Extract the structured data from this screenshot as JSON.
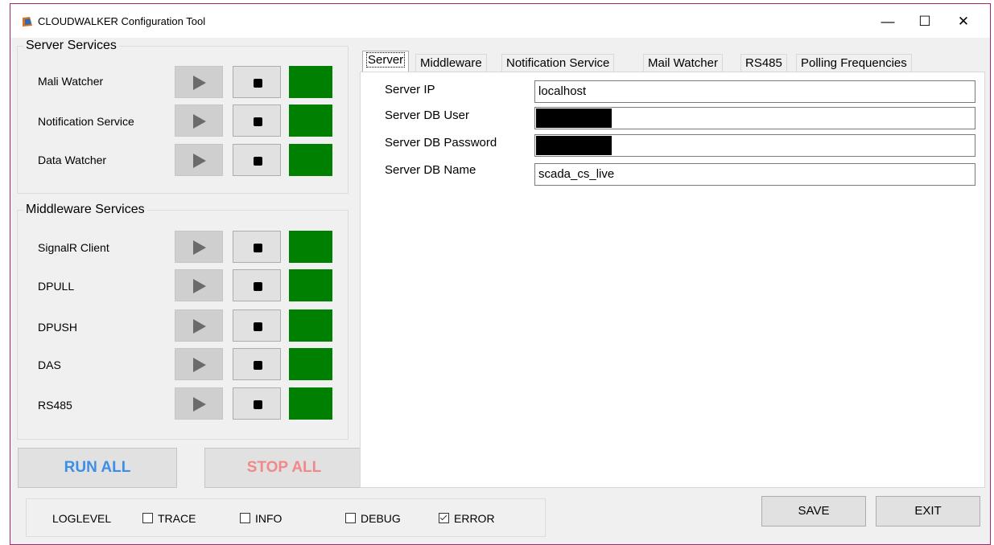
{
  "window": {
    "title": "CLOUDWALKER Configuration Tool",
    "controls": {
      "minimize": "—",
      "maximize": "☐",
      "close": "✕"
    }
  },
  "server_services": {
    "title": "Server Services",
    "items": [
      {
        "label": "Mali Watcher"
      },
      {
        "label": "Notification Service"
      },
      {
        "label": "Data Watcher"
      }
    ]
  },
  "middleware_services": {
    "title": "Middleware Services",
    "items": [
      {
        "label": "SignalR Client"
      },
      {
        "label": "DPULL"
      },
      {
        "label": "DPUSH"
      },
      {
        "label": "DAS"
      },
      {
        "label": "RS485"
      }
    ]
  },
  "actions": {
    "run_all": "RUN ALL",
    "stop_all": "STOP ALL"
  },
  "loglevel": {
    "label": "LOGLEVEL",
    "options": [
      {
        "label": "TRACE",
        "checked": false
      },
      {
        "label": "INFO",
        "checked": false
      },
      {
        "label": "DEBUG",
        "checked": false
      },
      {
        "label": "ERROR",
        "checked": true
      }
    ]
  },
  "tabs": [
    "Server",
    "Middleware",
    "Notification Service",
    "Mail Watcher",
    "RS485",
    "Polling Frequencies"
  ],
  "active_tab": "Server",
  "server_tab": {
    "fields": [
      {
        "label": "Server IP",
        "value": "localhost",
        "masked": false
      },
      {
        "label": "Server DB User",
        "value": "",
        "masked": true
      },
      {
        "label": "Server DB Password",
        "value": "",
        "masked": true
      },
      {
        "label": "Server DB Name",
        "value": "scada_cs_live",
        "masked": false
      }
    ]
  },
  "footer": {
    "save": "SAVE",
    "exit": "EXIT"
  },
  "colors": {
    "status_running": "#008000",
    "run_all_text": "#3c8ee6",
    "stop_all_text": "#f08a8a",
    "window_border": "#9b2a6f"
  },
  "icons": {
    "start": "play-icon",
    "stop": "stop-icon",
    "app": "cloudwalker-app-icon"
  }
}
